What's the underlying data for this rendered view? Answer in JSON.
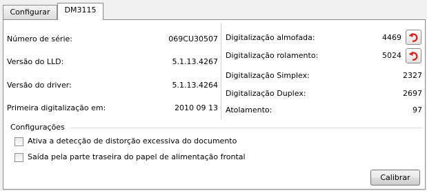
{
  "tabs": [
    {
      "label": "Configurar"
    },
    {
      "label": "DM3115"
    }
  ],
  "left_info": [
    {
      "label": "Número de série:",
      "value": "069CU30507"
    },
    {
      "label": "Versão do LLD:",
      "value": "5.1.13.4267"
    },
    {
      "label": "Versão do driver:",
      "value": "5.1.13.4264"
    },
    {
      "label": "Primeira digitalização em:",
      "value": "2010 09 13"
    }
  ],
  "right_info": [
    {
      "label": "Digitalização almofada:",
      "value": "4469",
      "reset_icon": "undo-arrow-icon"
    },
    {
      "label": "Digitalização rolamento:",
      "value": "5024",
      "reset_icon": "undo-arrow-icon"
    },
    {
      "label": "Digitalização Simplex:",
      "value": "2327"
    },
    {
      "label": "Digitalização Duplex:",
      "value": "2697"
    },
    {
      "label": "Atolamento:",
      "value": "97"
    }
  ],
  "settings_group": {
    "title": "Configurações",
    "options": [
      {
        "label": "Ativa a detecção de distorção excessiva do documento",
        "checked": false
      },
      {
        "label": "Saída pela parte traseira do papel de alimentação frontal",
        "checked": false
      }
    ]
  },
  "calibrate_button": {
    "label": "Calibrar"
  },
  "colors": {
    "reset_arrow": "#d9251c",
    "panel_border": "#898c95"
  }
}
